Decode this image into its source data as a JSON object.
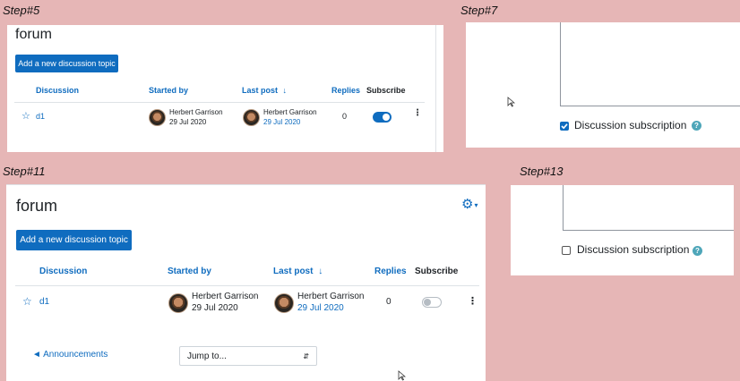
{
  "steps": {
    "s5": "Step#5",
    "s7": "Step#7",
    "s11": "Step#11",
    "s13": "Step#13"
  },
  "forum": {
    "title": "forum",
    "add_button": "Add a new discussion topic",
    "headers": {
      "discussion": "Discussion",
      "started_by": "Started by",
      "last_post": "Last post",
      "replies": "Replies",
      "subscribe": "Subscribe"
    },
    "row": {
      "topic": "d1",
      "starter_name": "Herbert Garrison",
      "starter_date": "29 Jul 2020",
      "last_name": "Herbert Garrison",
      "last_date": "29 Jul 2020",
      "replies": "0"
    },
    "subscribed_step5": true,
    "subscribed_step11": false,
    "announcements_link": "◄ Announcements",
    "jump_to": "Jump to..."
  },
  "subscription": {
    "label": "Discussion subscription",
    "checked_step7": true,
    "checked_step13": false,
    "help": "?"
  },
  "icons": {
    "star": "star-icon",
    "sort": "sort-desc-icon",
    "kebab": "more-actions-icon",
    "gear": "gear-icon",
    "help": "help-icon"
  },
  "colors": {
    "background": "#e6b6b6",
    "accent": "#0f6cbf",
    "toggle_off": "#ced4da",
    "help": "#4ea6b9"
  }
}
